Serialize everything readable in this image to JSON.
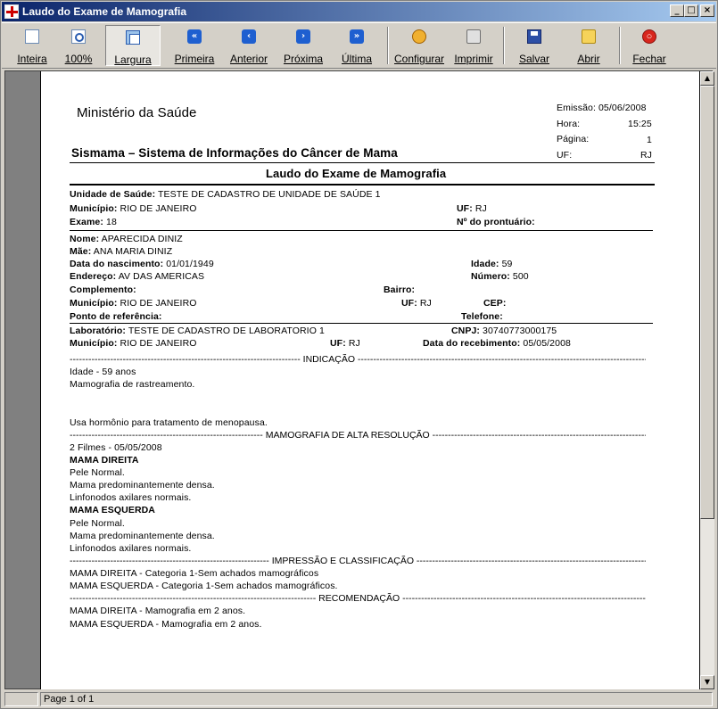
{
  "window": {
    "title": "Laudo do Exame de Mamografia"
  },
  "toolbar": {
    "inteira": "Inteira",
    "zoom100": "100%",
    "largura": "Largura",
    "primeira": "Primeira",
    "anterior": "Anterior",
    "proxima": "Próxima",
    "ultima": "Última",
    "configurar": "Configurar",
    "imprimir": "Imprimir",
    "salvar": "Salvar",
    "abrir": "Abrir",
    "fechar": "Fechar"
  },
  "report": {
    "ministry": "Ministério da Saúde",
    "sismama": "Sismama – Sistema de Informações do Câncer de Mama",
    "laudo_title": "Laudo do Exame de Mamografia",
    "meta": {
      "emissao": "Emissão: 05/06/2008",
      "hora_label": "Hora:",
      "hora": "15:25",
      "pagina_label": "Página:",
      "pagina": "1",
      "uf_label": "UF:",
      "uf": "RJ"
    },
    "unidade": {
      "label": "Unidade de Saúde:",
      "value": "TESTE DE CADASTRO DE UNIDADE DE SAÚDE 1"
    },
    "municipio1": {
      "label": "Município:",
      "value": "RIO DE JANEIRO"
    },
    "uf1": {
      "label": "UF:",
      "value": "RJ"
    },
    "exame": {
      "label": "Exame:",
      "value": "18"
    },
    "prontuario": {
      "label": "Nº do prontuário:",
      "value": ""
    },
    "nome": {
      "label": "Nome:",
      "value": "APARECIDA DINIZ"
    },
    "mae": {
      "label": "Mãe:",
      "value": "ANA MARIA DINIZ"
    },
    "nascimento": {
      "label": "Data do nascimento:",
      "value": "01/01/1949"
    },
    "idade": {
      "label": "Idade:",
      "value": "59"
    },
    "endereco": {
      "label": "Endereço:",
      "value": "AV DAS AMERICAS"
    },
    "numero": {
      "label": "Número:",
      "value": "500"
    },
    "complemento": {
      "label": "Complemento:",
      "value": ""
    },
    "bairro": {
      "label": "Bairro:",
      "value": ""
    },
    "municipio2": {
      "label": "Município:",
      "value": "RIO DE JANEIRO"
    },
    "uf2": {
      "label": "UF:",
      "value": "RJ"
    },
    "cep": {
      "label": "CEP:",
      "value": ""
    },
    "referencia": {
      "label": "Ponto de referência:",
      "value": ""
    },
    "telefone": {
      "label": "Telefone:",
      "value": ""
    },
    "laboratorio": {
      "label": "Laboratório:",
      "value": "TESTE DE CADASTRO DE LABORATORIO 1"
    },
    "cnpj": {
      "label": "CNPJ:",
      "value": "30740773000175"
    },
    "municipio3": {
      "label": "Município:",
      "value": "RIO DE JANEIRO"
    },
    "uf3": {
      "label": "UF:",
      "value": "RJ"
    },
    "recebimento": {
      "label": "Data do recebimento:",
      "value": "05/05/2008"
    },
    "sec_indicacao": "INDICAÇÃO",
    "indicacao_lines": [
      "Idade - 59 anos",
      "Mamografia de rastreamento.",
      "",
      "",
      "Usa hormônio para tratamento de menopausa."
    ],
    "sec_mamografia": "MAMOGRAFIA DE ALTA RESOLUÇÃO",
    "filmes": "2 Filmes - 05/05/2008",
    "mama_direita_title": "MAMA DIREITA",
    "mama_direita_lines": [
      "Pele Normal.",
      "Mama predominantemente densa.",
      "Linfonodos axilares normais."
    ],
    "mama_esquerda_title": "MAMA ESQUERDA",
    "mama_esquerda_lines": [
      "Pele Normal.",
      "Mama predominantemente densa.",
      "Linfonodos axilares normais."
    ],
    "sec_impressao": "IMPRESSÃO E CLASSIFICAÇÃO",
    "impressao_lines": [
      "MAMA DIREITA - Categoria 1-Sem achados mamográficos",
      "MAMA ESQUERDA - Categoria 1-Sem achados mamográficos."
    ],
    "sec_recomendacao": "RECOMENDAÇÃO",
    "recomendacao_lines": [
      "MAMA DIREITA - Mamografia em 2 anos.",
      "MAMA ESQUERDA - Mamografia em 2 anos."
    ]
  },
  "status": {
    "page_info": "Page 1 of 1"
  }
}
